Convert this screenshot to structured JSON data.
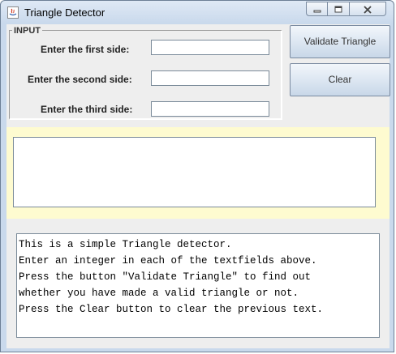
{
  "window": {
    "title": "Triangle Detector",
    "controls": [
      "minimize-icon",
      "maximize-icon",
      "close-icon"
    ]
  },
  "input_panel": {
    "legend": "INPUT",
    "fields": [
      {
        "label": "Enter the first side:",
        "value": ""
      },
      {
        "label": "Enter the second side:",
        "value": ""
      },
      {
        "label": "Enter the third side:",
        "value": ""
      }
    ]
  },
  "buttons": {
    "validate": "Validate Triangle",
    "clear": "Clear"
  },
  "result": {
    "text": ""
  },
  "info": {
    "lines": [
      "This is a simple Triangle detector.",
      "Enter an integer in each of the textfields above.",
      "Press the button \"Validate Triangle\" to find out",
      "whether you have made a valid triangle or not.",
      "Press the Clear button to clear the previous text."
    ]
  },
  "colors": {
    "result_panel_bg": "#fefbd0",
    "window_frame": "#c9d9ec"
  }
}
